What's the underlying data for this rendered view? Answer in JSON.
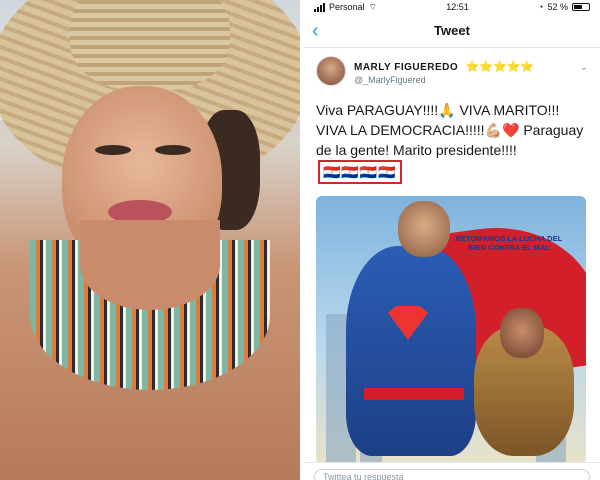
{
  "status_bar": {
    "carrier": "Personal",
    "time": "12:51",
    "battery": "52 %"
  },
  "nav": {
    "back_icon": "chevron-left-icon",
    "title": "Tweet"
  },
  "tweet": {
    "author_name": "MARLY FIGUEREDO",
    "author_stars": "⭐⭐⭐⭐⭐",
    "handle": "@_MarlyFiguered",
    "text_part1": "Viva PARAGUAY!!!!🙏 VIVA MARITO!!! VIVA LA DEMOCRACIA!!!!!💪🏼❤️ Paraguay de la gente! Marito presidente!!!! ",
    "flags": "🇵🇾🇵🇾🇵🇾🇵🇾",
    "image_slogan": "RETOMAMOS LA LUCHA DEL BIEN CONTRA EL MAL"
  },
  "reply": {
    "placeholder": "Twittea tu respuesta"
  },
  "colors": {
    "accent": "#1da1f2",
    "highlight_box": "#d8252c"
  }
}
